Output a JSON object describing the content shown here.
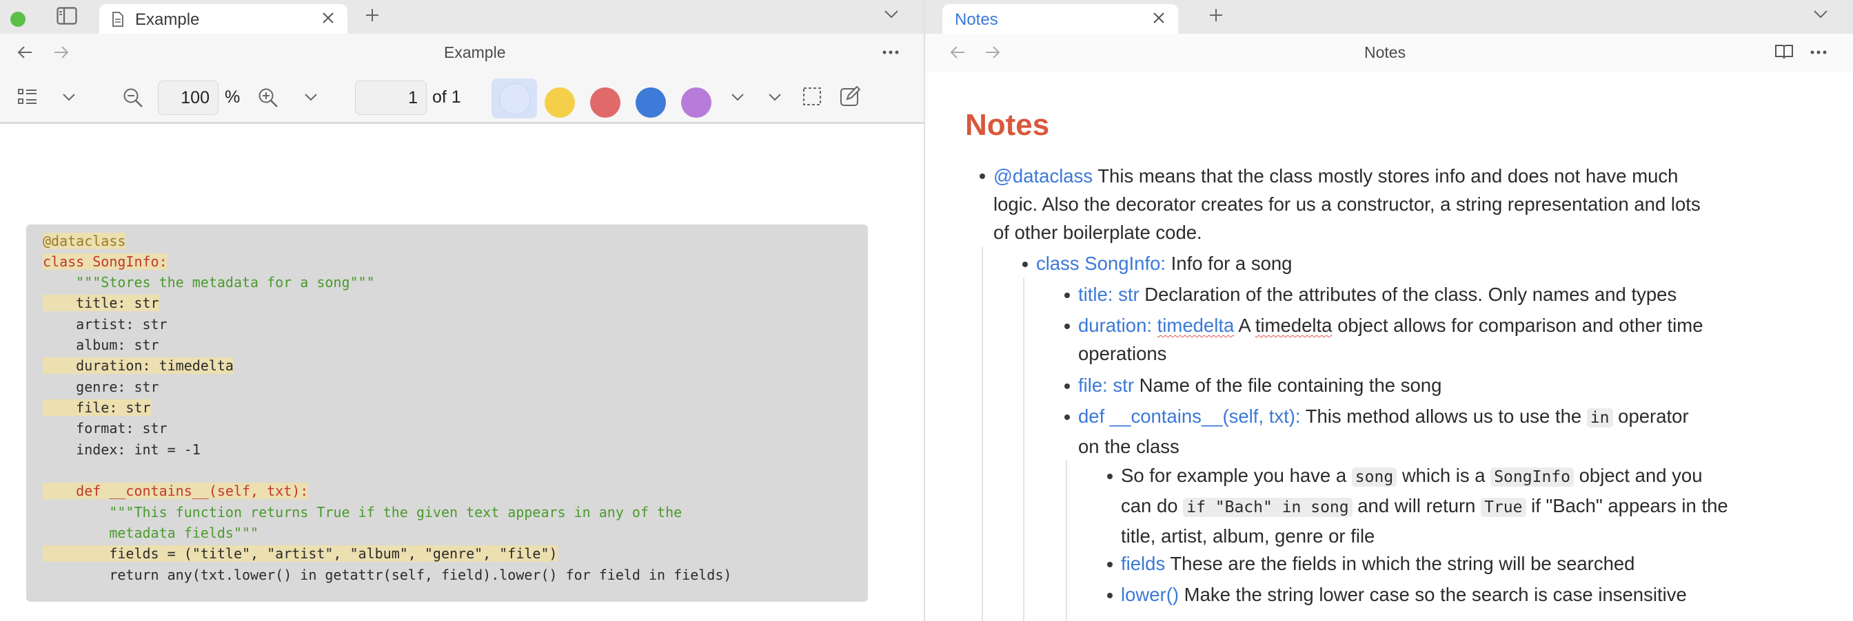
{
  "left_pane": {
    "tab_title": "Example",
    "nav_title": "Example",
    "toolbar": {
      "zoom_value": "100",
      "zoom_unit": "%",
      "page_value": "1",
      "page_of": "of 1",
      "colors": {
        "selected": "#dde6fb",
        "yellow": "#f5cf4a",
        "red": "#e06a6a",
        "blue": "#3e7bd8",
        "purple": "#b77cd9"
      }
    },
    "code": [
      "@dataclass",
      "class SongInfo:",
      "    \"\"\"Stores the metadata for a song\"\"\"",
      "    title: str",
      "    artist: str",
      "    album: str",
      "    duration: timedelta",
      "    genre: str",
      "    file: str",
      "    format: str",
      "    index: int = -1",
      "",
      "    def __contains__(self, txt):",
      "        \"\"\"This function returns True if the given text appears in any of the",
      "        metadata fields\"\"\"",
      "        fields = (\"title\", \"artist\", \"album\", \"genre\", \"file\")",
      "        return any(txt.lower() in getattr(self, field).lower() for field in fields)"
    ]
  },
  "right_pane": {
    "tab_title": "Notes",
    "nav_title": "Notes",
    "heading": "Notes",
    "items": {
      "dataclass_link": "@dataclass",
      "dataclass_text_1": "This means that the class mostly stores info and does not have much",
      "dataclass_text_2": "logic. Also the decorator creates for us a constructor, a string representation and lots",
      "dataclass_text_3": "of other boilerplate code.",
      "songinfo_link": "class SongInfo:",
      "songinfo_text": "Info for a song",
      "title_link": "title: str",
      "title_text": "Declaration of the attributes of the class. Only names and types",
      "duration_link": "duration:",
      "duration_link_word": "timedelta",
      "duration_text_a": "A",
      "duration_text_word": "timedelta",
      "duration_text_b": "object allows for comparison and other time",
      "duration_text_2": "operations",
      "file_link": "file: str",
      "file_text": "Name of the file containing the song",
      "contains_link": "def __contains__(self, txt):",
      "contains_text_1": "This method allows us to use the",
      "contains_code": "in",
      "contains_text_2": "operator",
      "contains_text_3": "on the class",
      "example_1a": "So for example you have a",
      "example_code_song": "song",
      "example_1b": "which is a",
      "example_code_songinfo": "SongInfo",
      "example_1c": "object and you",
      "example_2a": "can do",
      "example_code_if": "if \"Bach\" in song",
      "example_2b": "and will return",
      "example_code_true": "True",
      "example_2c": "if \"Bach\" appears in the",
      "example_3": "title, artist, album, genre or file",
      "fields_link": "fields",
      "fields_text": "These are the fields in which the string will be searched",
      "lower_link": "lower()",
      "lower_text": "Make the string lower case so the search is case insensitive"
    }
  },
  "icons": [
    "sidebar-icon",
    "document-icon",
    "close-icon",
    "plus-icon",
    "chevron-down-icon",
    "back-arrow-icon",
    "forward-arrow-icon",
    "more-icon",
    "list-icon",
    "zoom-out-icon",
    "zoom-in-icon",
    "selection-icon",
    "edit-icon",
    "book-icon"
  ]
}
